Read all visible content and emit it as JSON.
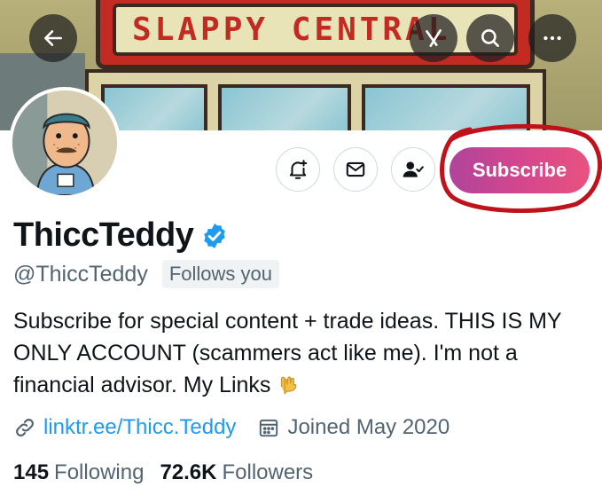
{
  "banner": {
    "sign_text": "SLAPPY CENTRAL"
  },
  "overlay": {
    "back_icon": "arrow-left-icon",
    "grok_icon": "grok-icon",
    "search_icon": "search-icon",
    "more_icon": "more-horizontal-icon"
  },
  "actions": {
    "notify_icon": "bell-plus-icon",
    "message_icon": "envelope-icon",
    "follow_icon": "person-check-icon",
    "subscribe_label": "Subscribe"
  },
  "profile": {
    "display_name": "ThiccTeddy",
    "handle": "@ThiccTeddy",
    "follows_you": "Follows you",
    "bio_text": "Subscribe for special content + trade ideas. THIS IS MY ONLY ACCOUNT (scammers act like me). I'm not a financial advisor. My Links",
    "link": "linktr.ee/Thicc.Teddy",
    "joined": "Joined May 2020"
  },
  "stats": {
    "following_count": "145",
    "following_label": "Following",
    "followers_count": "72.6K",
    "followers_label": "Followers"
  },
  "colors": {
    "accent_link": "#1d9bf0",
    "verified": "#1d9bf0",
    "subscribe_gradient_start": "#b0449b",
    "subscribe_gradient_end": "#e9537f",
    "annotation_circle": "#c0121b",
    "secondary_text": "#536471"
  }
}
